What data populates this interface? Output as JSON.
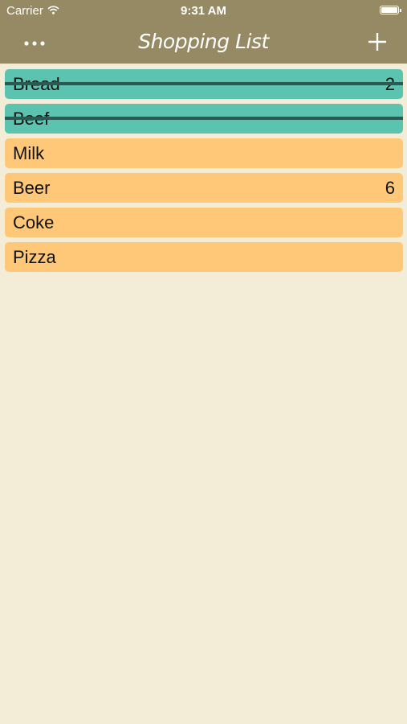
{
  "status": {
    "carrier": "Carrier",
    "time": "9:31 AM"
  },
  "nav": {
    "title": "Shopping List",
    "more_icon": "more-dots-icon",
    "add_icon": "plus-icon"
  },
  "colors": {
    "bar": "#958a63",
    "background": "#f3ecd6",
    "pending_item": "#ffc879",
    "done_item": "#5cc3b0",
    "strike": "#2c5a52"
  },
  "items": [
    {
      "name": "Bread",
      "qty": "2",
      "done": true
    },
    {
      "name": "Beef",
      "qty": "",
      "done": true
    },
    {
      "name": "Milk",
      "qty": "",
      "done": false
    },
    {
      "name": "Beer",
      "qty": "6",
      "done": false
    },
    {
      "name": "Coke",
      "qty": "",
      "done": false
    },
    {
      "name": "Pizza",
      "qty": "",
      "done": false
    }
  ]
}
